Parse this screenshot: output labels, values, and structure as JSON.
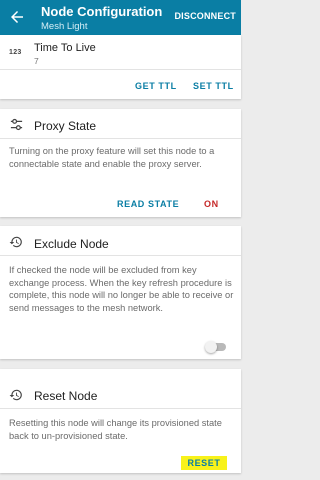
{
  "appbar": {
    "title": "Node Configuration",
    "subtitle": "Mesh Light",
    "disconnect_label": "DISCONNECT"
  },
  "ttl": {
    "icon_text": "123",
    "heading": "Time To Live",
    "value": "7",
    "get_label": "GET TTL",
    "set_label": "SET TTL"
  },
  "proxy": {
    "heading": "Proxy State",
    "description": "Turning on the proxy feature will set this node to a connectable state and enable the proxy server.",
    "read_label": "READ STATE",
    "toggle_label": "ON"
  },
  "exclude": {
    "heading": "Exclude Node",
    "description": "If checked the node will be excluded from key exchange process. When the key refresh procedure is complete, this node will no longer be able to receive or send messages to the mesh network.",
    "checked": false
  },
  "reset": {
    "heading": "Reset Node",
    "description": "Resetting this node will change its provisioned state back to un-provisioned state.",
    "button_label": "RESET"
  },
  "colors": {
    "primary": "#0a7ea4",
    "accent_red": "#c62828",
    "highlight": "#f8f21a"
  }
}
